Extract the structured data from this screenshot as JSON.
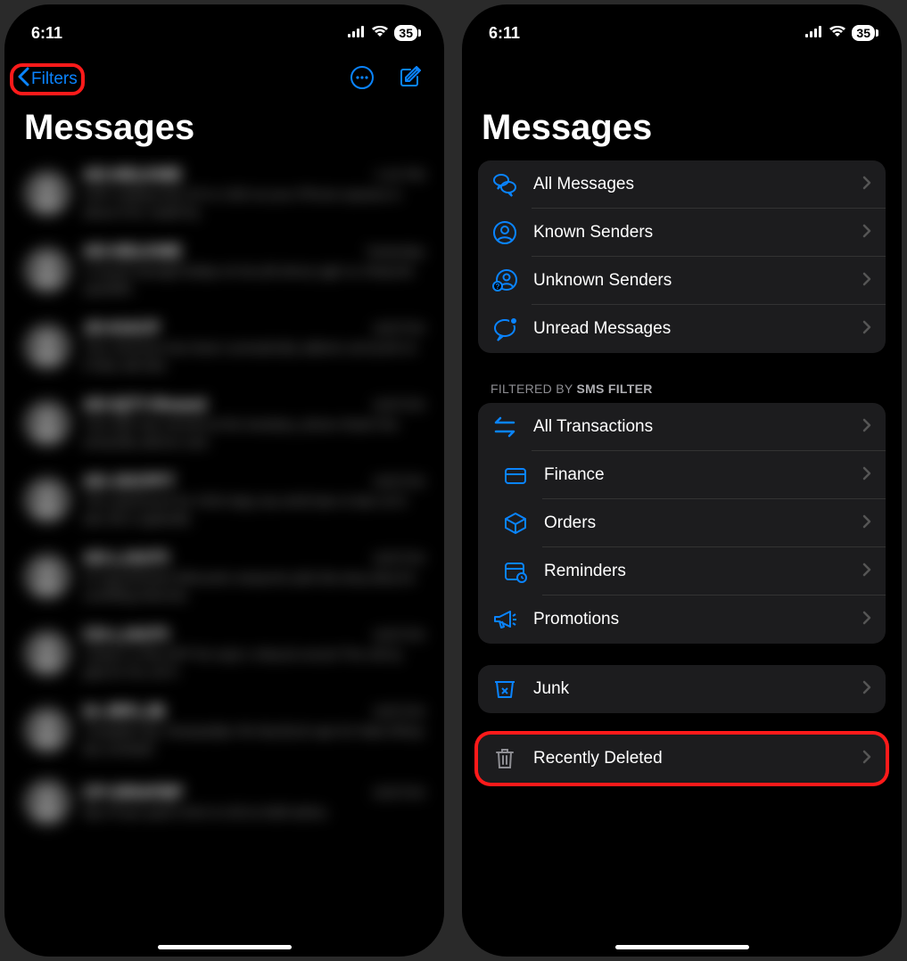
{
  "status": {
    "time": "6:11",
    "battery": "35"
  },
  "left": {
    "nav": {
      "back": "Filters"
    },
    "title": "Messages"
  },
  "right": {
    "title": "Messages",
    "group1": [
      {
        "label": "All Messages"
      },
      {
        "label": "Known Senders"
      },
      {
        "label": "Unknown Senders"
      },
      {
        "label": "Unread Messages"
      }
    ],
    "section2_header_prefix": "Filtered by ",
    "section2_header_bold": "SMS Filter",
    "group2": [
      {
        "label": "All Transactions"
      },
      {
        "label": "Finance"
      },
      {
        "label": "Orders"
      },
      {
        "label": "Reminders"
      },
      {
        "label": "Promotions"
      }
    ],
    "group3": [
      {
        "label": "Junk"
      }
    ],
    "group4": [
      {
        "label": "Recently Deleted"
      }
    ]
  }
}
